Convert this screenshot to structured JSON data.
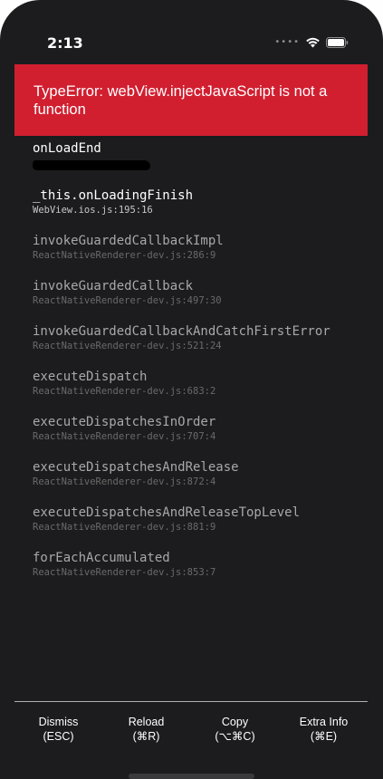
{
  "status_bar": {
    "time": "2:13",
    "signal_icon": "cellular-signal-icon",
    "wifi_icon": "wifi-icon",
    "battery_icon": "battery-icon"
  },
  "error": {
    "message": "TypeError: webView.injectJavaScript is not a function"
  },
  "stack": [
    {
      "method": "onLoadEnd",
      "file": ""
    },
    {
      "method": "_this.onLoadingFinish",
      "file": "WebView.ios.js:195:16"
    },
    {
      "method": "invokeGuardedCallbackImpl",
      "file": "ReactNativeRenderer-dev.js:286:9"
    },
    {
      "method": "invokeGuardedCallback",
      "file": "ReactNativeRenderer-dev.js:497:30"
    },
    {
      "method": "invokeGuardedCallbackAndCatchFirstError",
      "file": "ReactNativeRenderer-dev.js:521:24"
    },
    {
      "method": "executeDispatch",
      "file": "ReactNativeRenderer-dev.js:683:2"
    },
    {
      "method": "executeDispatchesInOrder",
      "file": "ReactNativeRenderer-dev.js:707:4"
    },
    {
      "method": "executeDispatchesAndRelease",
      "file": "ReactNativeRenderer-dev.js:872:4"
    },
    {
      "method": "executeDispatchesAndReleaseTopLevel",
      "file": "ReactNativeRenderer-dev.js:881:9"
    },
    {
      "method": "forEachAccumulated",
      "file": "ReactNativeRenderer-dev.js:853:7"
    }
  ],
  "footer": {
    "dismiss": {
      "label": "Dismiss",
      "shortcut": "(ESC)"
    },
    "reload": {
      "label": "Reload",
      "shortcut": "(⌘R)"
    },
    "copy": {
      "label": "Copy",
      "shortcut": "(⌥⌘C)"
    },
    "extra_info": {
      "label": "Extra Info",
      "shortcut": "(⌘E)"
    }
  },
  "colors": {
    "background": "#1c1c1e",
    "error_banner": "#d11f30",
    "active_text": "#ffffff",
    "dim_text": "#a8a8a8"
  }
}
